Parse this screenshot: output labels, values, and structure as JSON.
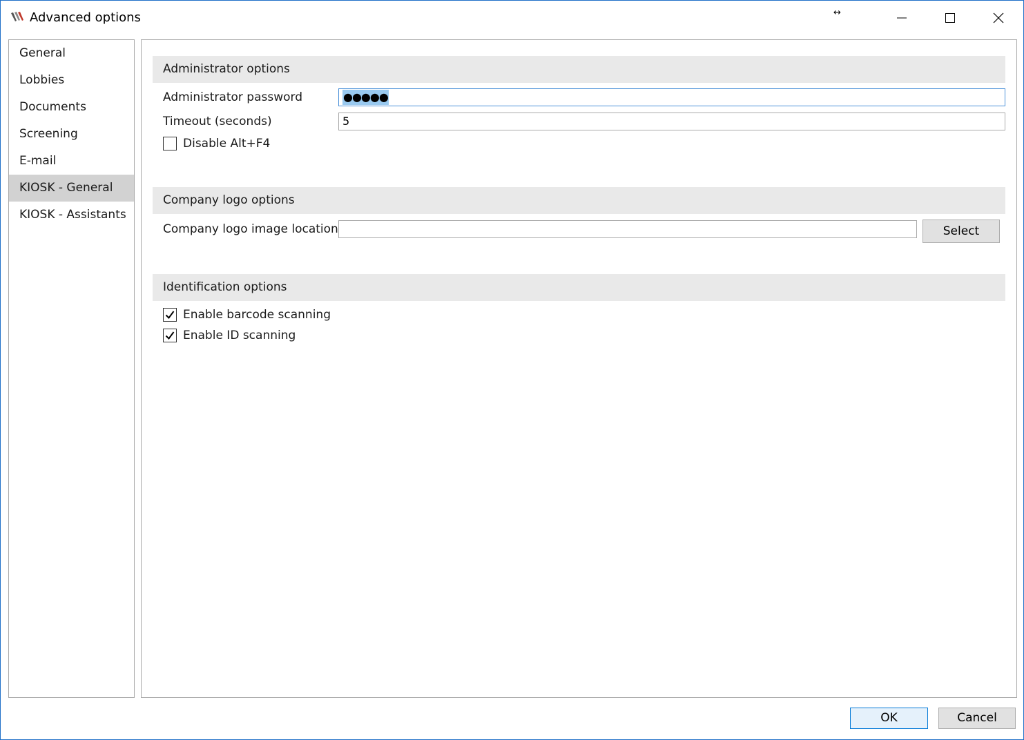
{
  "window": {
    "title": "Advanced options",
    "resize_hint": "↔"
  },
  "sidebar": {
    "items": [
      {
        "label": "General"
      },
      {
        "label": "Lobbies"
      },
      {
        "label": "Documents"
      },
      {
        "label": "Screening"
      },
      {
        "label": "E-mail"
      },
      {
        "label": "KIOSK - General",
        "selected": true
      },
      {
        "label": "KIOSK - Assistants"
      }
    ]
  },
  "administrator": {
    "header": "Administrator options",
    "password_label": "Administrator password",
    "password_mask": "●●●●●",
    "timeout_label": "Timeout (seconds)",
    "timeout_value": "5",
    "disable_altf4_label": "Disable Alt+F4",
    "disable_altf4_checked": false
  },
  "company_logo": {
    "header": "Company logo options",
    "location_label": "Company logo image location",
    "location_value": "",
    "select_label": "Select"
  },
  "identification": {
    "header": "Identification options",
    "barcode_label": "Enable barcode scanning",
    "barcode_checked": true,
    "id_label": "Enable ID scanning",
    "id_checked": true
  },
  "footer": {
    "ok_label": "OK",
    "cancel_label": "Cancel"
  },
  "colors": {
    "selected_item_bg": "#d2d2d2",
    "section_header_bg": "#e9e9e9",
    "selection_highlight": "#99c9ef",
    "window_border": "#1e6fc7"
  }
}
